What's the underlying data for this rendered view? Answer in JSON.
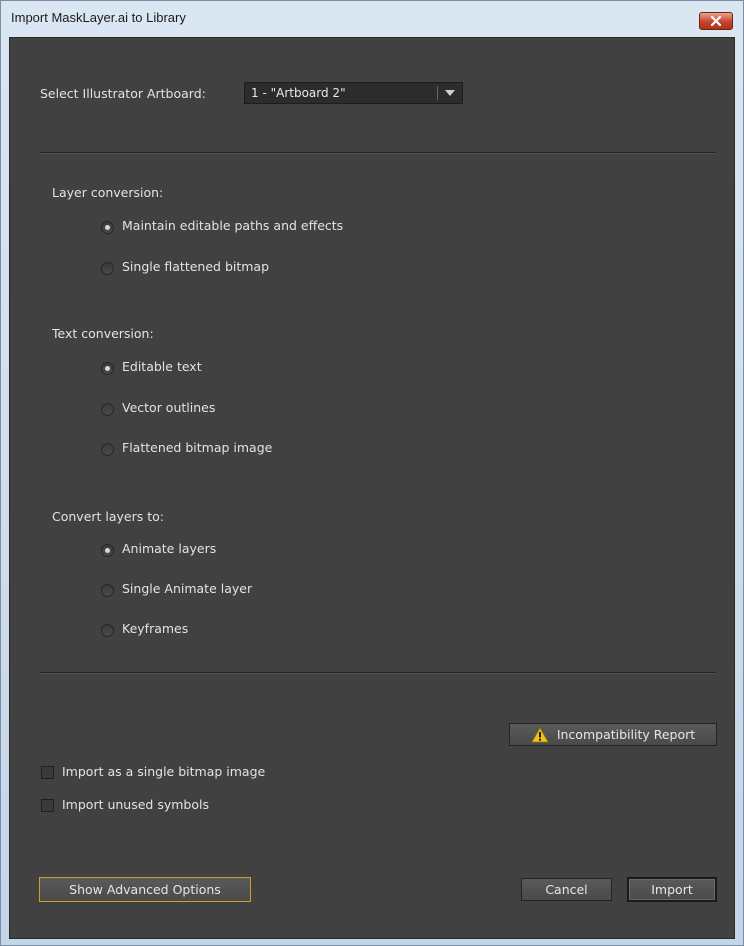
{
  "window": {
    "title": "Import MaskLayer.ai to Library"
  },
  "artboard": {
    "label": "Select Illustrator Artboard:",
    "value": "1 - \"Artboard 2\""
  },
  "layer_conversion": {
    "heading": "Layer conversion:",
    "options": [
      {
        "label": "Maintain editable paths and effects",
        "checked": true
      },
      {
        "label": "Single flattened bitmap",
        "checked": false
      }
    ]
  },
  "text_conversion": {
    "heading": "Text conversion:",
    "options": [
      {
        "label": "Editable text",
        "checked": true
      },
      {
        "label": "Vector outlines",
        "checked": false
      },
      {
        "label": "Flattened bitmap image",
        "checked": false
      }
    ]
  },
  "convert_layers": {
    "heading": "Convert layers to:",
    "options": [
      {
        "label": "Animate layers",
        "checked": true
      },
      {
        "label": "Single Animate layer",
        "checked": false
      },
      {
        "label": "Keyframes",
        "checked": false
      }
    ]
  },
  "incompatibility_report": {
    "label": "Incompatibility Report",
    "icon": "warning-icon",
    "icon_color": "#f2c21c"
  },
  "checkboxes": [
    {
      "label": "Import as a single bitmap image",
      "checked": false
    },
    {
      "label": "Import unused symbols",
      "checked": false
    }
  ],
  "buttons": {
    "advanced": "Show Advanced Options",
    "cancel": "Cancel",
    "import": "Import"
  }
}
